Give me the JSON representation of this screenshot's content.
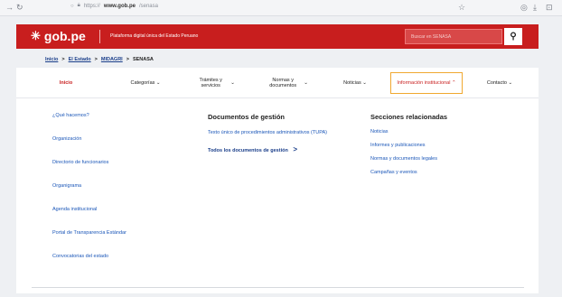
{
  "browser": {
    "url_prefix": "https://",
    "url_domain": "www.gob.pe",
    "url_path": "/senasa",
    "back_icon": "back-arrow-icon",
    "reload_icon": "reload-icon"
  },
  "header": {
    "logo_text": "gob.pe",
    "platform_text": "Plataforma digital única del Estado Peruano",
    "search_placeholder": "Buscar en SENASA",
    "accent": "#c81e1e"
  },
  "breadcrumb": {
    "items": [
      "Inicio",
      "El Estado",
      "MIDAGRI",
      "SENASA"
    ],
    "sep": ">"
  },
  "nav": {
    "items": [
      {
        "label": "Inicio"
      },
      {
        "label": "Categorías ⌄"
      },
      {
        "label": "Trámites y servicios"
      },
      {
        "label": "Normas y documentos"
      },
      {
        "label": "Noticias ⌄"
      },
      {
        "label": "Información institucional ⌃"
      },
      {
        "label": "Contacto ⌄"
      }
    ],
    "chev": "⌄"
  },
  "menu": {
    "col1": [
      "¿Qué hacemos?",
      "Organización",
      "Directorio de funcionarios",
      "Organigrama",
      "Agenda institucional",
      "Portal de Transparencia Estándar",
      "Convocatorias del estado"
    ],
    "col2": {
      "title": "Documentos de gestión",
      "link": "Texto único de procedimientos administrativos (TUPA)",
      "all": "Todos los documentos de gestión",
      "all_arrow": ">"
    },
    "col3": {
      "title": "Secciones relacionadas",
      "links": [
        "Noticias",
        "Informes y publicaciones",
        "Normas y documentos legales",
        "Campañas y eventos"
      ]
    }
  }
}
